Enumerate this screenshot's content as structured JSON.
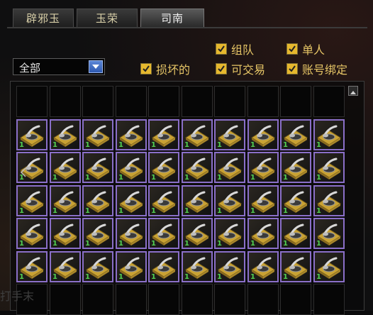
{
  "tabs": [
    {
      "label": "辟邪玉",
      "active": false
    },
    {
      "label": "玉荣",
      "active": false
    },
    {
      "label": "司南",
      "active": true
    }
  ],
  "filter": {
    "selected": "全部"
  },
  "checkboxes": [
    {
      "label": "组队",
      "checked": true
    },
    {
      "label": "单人",
      "checked": true
    },
    {
      "label": "损坏的",
      "checked": true
    },
    {
      "label": "可交易",
      "checked": true
    },
    {
      "label": "账号绑定",
      "checked": true
    }
  ],
  "inventory": {
    "item_icon": "compass-sinan-icon",
    "item_count": "1",
    "rows": 7,
    "cols": 10,
    "filled_rows": 5
  },
  "colors": {
    "accent_gold": "#e6b82e",
    "item_border": "#8a6fc8",
    "count_green": "#52d052"
  },
  "footer": {
    "text": "打手末"
  }
}
